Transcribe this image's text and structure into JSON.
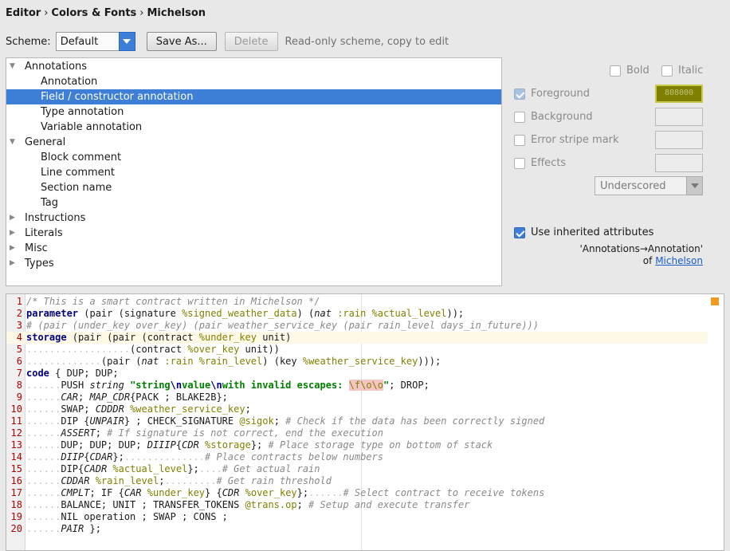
{
  "breadcrumb": [
    "Editor",
    "Colors & Fonts",
    "Michelson"
  ],
  "scheme": {
    "label": "Scheme:",
    "value": "Default",
    "save_as": "Save As...",
    "delete": "Delete",
    "note": "Read-only scheme, copy to edit"
  },
  "tree": {
    "items": [
      {
        "label": "Annotations",
        "level": 0,
        "expanded": true
      },
      {
        "label": "Annotation",
        "level": 1
      },
      {
        "label": "Field / constructor annotation",
        "level": 1,
        "selected": true
      },
      {
        "label": "Type annotation",
        "level": 1
      },
      {
        "label": "Variable annotation",
        "level": 1
      },
      {
        "label": "General",
        "level": 0,
        "expanded": true
      },
      {
        "label": "Block comment",
        "level": 1
      },
      {
        "label": "Line comment",
        "level": 1
      },
      {
        "label": "Section name",
        "level": 1
      },
      {
        "label": "Tag",
        "level": 1
      },
      {
        "label": "Instructions",
        "level": 0,
        "expanded": false
      },
      {
        "label": "Literals",
        "level": 0,
        "expanded": false
      },
      {
        "label": "Misc",
        "level": 0,
        "expanded": false
      },
      {
        "label": "Types",
        "level": 0,
        "expanded": false
      }
    ]
  },
  "attributes": {
    "bold": "Bold",
    "italic": "Italic",
    "foreground": "Foreground",
    "foreground_value": "808000",
    "foreground_color": "#808000",
    "background": "Background",
    "error_stripe": "Error stripe mark",
    "effects": "Effects",
    "effects_type": "Underscored",
    "use_inherited": "Use inherited attributes",
    "inherited_from": "'Annotations→Annotation'",
    "of": "of",
    "inherited_link": "Michelson"
  },
  "colors": {
    "accent": "#3d7fd6",
    "line_number": "#b00000",
    "annotation": "#808000",
    "keyword": "#000080",
    "string": "#008000",
    "comment": "#8a8a8a",
    "marker": "#f09a24"
  },
  "icons": [
    "tree-expanded-icon",
    "tree-collapsed-icon",
    "dropdown-arrow-icon",
    "checkbox-icon",
    "error-stripe-marker-icon"
  ],
  "editor": {
    "current_line": 4,
    "lines": [
      [
        {
          "t": "/* This is a smart contract written in Michelson */",
          "c": "cmt"
        }
      ],
      [
        {
          "t": "parameter",
          "c": "kw"
        },
        {
          "t": " (pair (signature "
        },
        {
          "t": "%signed_weather_data",
          "c": "ann"
        },
        {
          "t": ") ("
        },
        {
          "t": "nat",
          "c": "it"
        },
        {
          "t": " "
        },
        {
          "t": ":rain",
          "c": "ann"
        },
        {
          "t": " "
        },
        {
          "t": "%actual_level",
          "c": "ann"
        },
        {
          "t": "));"
        }
      ],
      [
        {
          "t": "# (pair (under_key over_key) (pair weather_service_key (pair rain_level days_in_future)))",
          "c": "cmt"
        }
      ],
      [
        {
          "t": "storage",
          "c": "kw"
        },
        {
          "t": " (pair (pair (contract "
        },
        {
          "t": "%under_key",
          "c": "ann"
        },
        {
          "t": " unit)"
        }
      ],
      [
        {
          "t": "                  ",
          "c": "ws"
        },
        {
          "t": "(contract "
        },
        {
          "t": "%over_key",
          "c": "ann"
        },
        {
          "t": " unit))"
        }
      ],
      [
        {
          "t": "             ",
          "c": "ws"
        },
        {
          "t": "(pair ("
        },
        {
          "t": "nat",
          "c": "it"
        },
        {
          "t": " "
        },
        {
          "t": ":rain",
          "c": "ann"
        },
        {
          "t": " "
        },
        {
          "t": "%rain_level",
          "c": "ann"
        },
        {
          "t": ") (key "
        },
        {
          "t": "%weather_service_key",
          "c": "ann"
        },
        {
          "t": ")));"
        }
      ],
      [
        {
          "t": "code",
          "c": "kw"
        },
        {
          "t": " { DUP; DUP;"
        }
      ],
      [
        {
          "t": "      ",
          "c": "ws"
        },
        {
          "t": "PUSH "
        },
        {
          "t": "string",
          "c": "it"
        },
        {
          "t": " "
        },
        {
          "t": "\"string",
          "c": "str"
        },
        {
          "t": "\\n",
          "c": "esc"
        },
        {
          "t": "value",
          "c": "str"
        },
        {
          "t": "\\n",
          "c": "esc"
        },
        {
          "t": "with invalid escapes: ",
          "c": "str"
        },
        {
          "t": "\\f\\o\\o",
          "c": "bad"
        },
        {
          "t": "\"",
          "c": "str"
        },
        {
          "t": "; DROP;"
        }
      ],
      [
        {
          "t": "      ",
          "c": "ws"
        },
        {
          "t": "CAR",
          "c": "it"
        },
        {
          "t": "; "
        },
        {
          "t": "MAP_CDR",
          "c": "it"
        },
        {
          "t": "{PACK ; BLAKE2B};"
        }
      ],
      [
        {
          "t": "      ",
          "c": "ws"
        },
        {
          "t": "SWAP; "
        },
        {
          "t": "CDDDR",
          "c": "it"
        },
        {
          "t": " "
        },
        {
          "t": "%weather_service_key",
          "c": "ann"
        },
        {
          "t": ";"
        }
      ],
      [
        {
          "t": "      ",
          "c": "ws"
        },
        {
          "t": "DIP {"
        },
        {
          "t": "UNPAIR",
          "c": "it"
        },
        {
          "t": "} ; CHECK_SIGNATURE "
        },
        {
          "t": "@sigok",
          "c": "ann"
        },
        {
          "t": "; "
        },
        {
          "t": "# Check if the data has been correctly signed",
          "c": "cmt"
        }
      ],
      [
        {
          "t": "      ",
          "c": "ws"
        },
        {
          "t": "ASSERT",
          "c": "it"
        },
        {
          "t": "; "
        },
        {
          "t": "# If signature is not correct, end the execution",
          "c": "cmt"
        }
      ],
      [
        {
          "t": "      ",
          "c": "ws"
        },
        {
          "t": "DUP; DUP; DUP; "
        },
        {
          "t": "DIIIP",
          "c": "it"
        },
        {
          "t": "{"
        },
        {
          "t": "CDR",
          "c": "it"
        },
        {
          "t": " "
        },
        {
          "t": "%storage",
          "c": "ann"
        },
        {
          "t": "}; "
        },
        {
          "t": "# Place storage type on bottom of stack",
          "c": "cmt"
        }
      ],
      [
        {
          "t": "      ",
          "c": "ws"
        },
        {
          "t": "DIIP",
          "c": "it"
        },
        {
          "t": "{"
        },
        {
          "t": "CDAR",
          "c": "it"
        },
        {
          "t": "};"
        },
        {
          "t": "              ",
          "c": "ws"
        },
        {
          "t": "# Place contracts below numbers",
          "c": "cmt"
        }
      ],
      [
        {
          "t": "      ",
          "c": "ws"
        },
        {
          "t": "DIP{"
        },
        {
          "t": "CADR",
          "c": "it"
        },
        {
          "t": " "
        },
        {
          "t": "%actual_level",
          "c": "ann"
        },
        {
          "t": "};"
        },
        {
          "t": "    ",
          "c": "ws"
        },
        {
          "t": "# Get actual rain",
          "c": "cmt"
        }
      ],
      [
        {
          "t": "      ",
          "c": "ws"
        },
        {
          "t": "CDDAR",
          "c": "it"
        },
        {
          "t": " "
        },
        {
          "t": "%rain_level",
          "c": "ann"
        },
        {
          "t": ";"
        },
        {
          "t": "         ",
          "c": "ws"
        },
        {
          "t": "# Get rain threshold",
          "c": "cmt"
        }
      ],
      [
        {
          "t": "      ",
          "c": "ws"
        },
        {
          "t": "CMPLT",
          "c": "it"
        },
        {
          "t": "; IF {"
        },
        {
          "t": "CAR",
          "c": "it"
        },
        {
          "t": " "
        },
        {
          "t": "%under_key",
          "c": "ann"
        },
        {
          "t": "} {"
        },
        {
          "t": "CDR",
          "c": "it"
        },
        {
          "t": " "
        },
        {
          "t": "%over_key",
          "c": "ann"
        },
        {
          "t": "};"
        },
        {
          "t": "      ",
          "c": "ws"
        },
        {
          "t": "# Select contract to receive tokens",
          "c": "cmt"
        }
      ],
      [
        {
          "t": "      ",
          "c": "ws"
        },
        {
          "t": "BALANCE; UNIT ; TRANSFER_TOKENS "
        },
        {
          "t": "@trans.op",
          "c": "ann"
        },
        {
          "t": "; "
        },
        {
          "t": "# Setup and execute transfer",
          "c": "cmt"
        }
      ],
      [
        {
          "t": "      ",
          "c": "ws"
        },
        {
          "t": "NIL operation ; SWAP ; CONS ;"
        }
      ],
      [
        {
          "t": "      ",
          "c": "ws"
        },
        {
          "t": "PAIR",
          "c": "it"
        },
        {
          "t": " };"
        }
      ]
    ]
  }
}
